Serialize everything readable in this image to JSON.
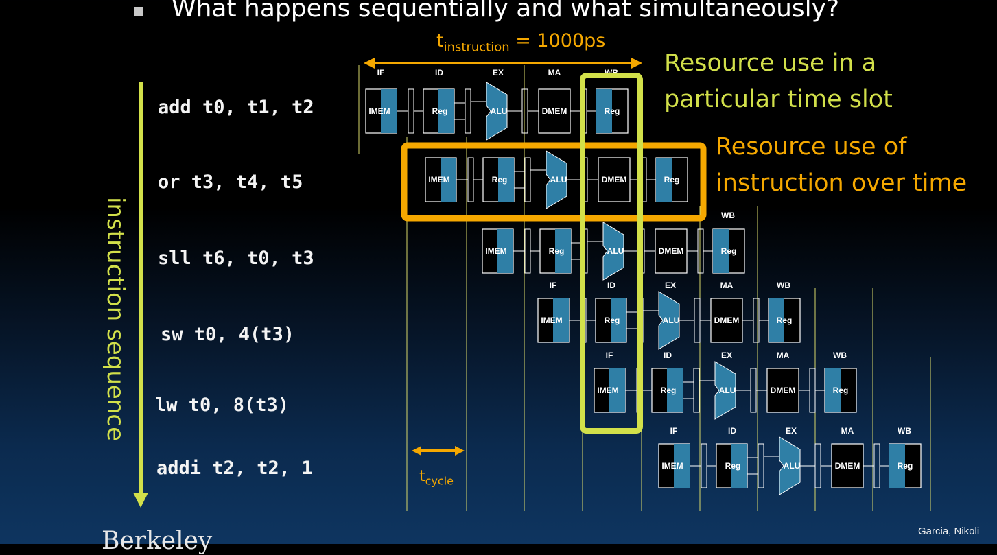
{
  "title": "What happens sequentially and what simultaneously?",
  "instructions": [
    "add t0, t1, t2",
    "or t3, t4, t5",
    "sll t6, t0, t3",
    "sw t0, 4(t3)",
    "lw t0, 8(t3)",
    "addi t2, t2, 1"
  ],
  "sequence_label": "instruction sequence",
  "t_instruction": {
    "symbol": "t",
    "sub": "instruction",
    "value": " = 1000ps"
  },
  "t_cycle": {
    "symbol": "t",
    "sub": "cycle"
  },
  "annotation_slot": [
    "Resource use in a",
    "particular time slot"
  ],
  "annotation_instr": [
    "Resource use of",
    "instruction over time"
  ],
  "stage_labels": [
    "IF",
    "ID",
    "EX",
    "MA",
    "WB"
  ],
  "units": {
    "imem": "IMEM",
    "reg": "Reg",
    "alu": "ALU",
    "dmem": "DMEM"
  },
  "footer_left": "Berkeley",
  "footer_right": "Garcia, Nikoli",
  "colors": {
    "stage_blue": "#2f7fa6",
    "highlight_green": "#d2e04a",
    "highlight_orange": "#f5a800",
    "guide_line": "#d8d86a"
  }
}
